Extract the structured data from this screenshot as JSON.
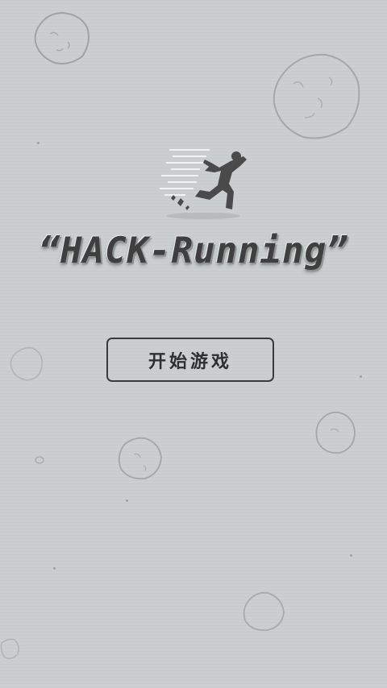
{
  "game": {
    "title": "“HACK-Running”",
    "start_button_label": "开始游戏"
  },
  "icons": {
    "hero": "running-man-icon",
    "decor": "asteroid-icon"
  },
  "colors": {
    "background": "#cbcfcf",
    "ink": "#3a3a3a"
  }
}
